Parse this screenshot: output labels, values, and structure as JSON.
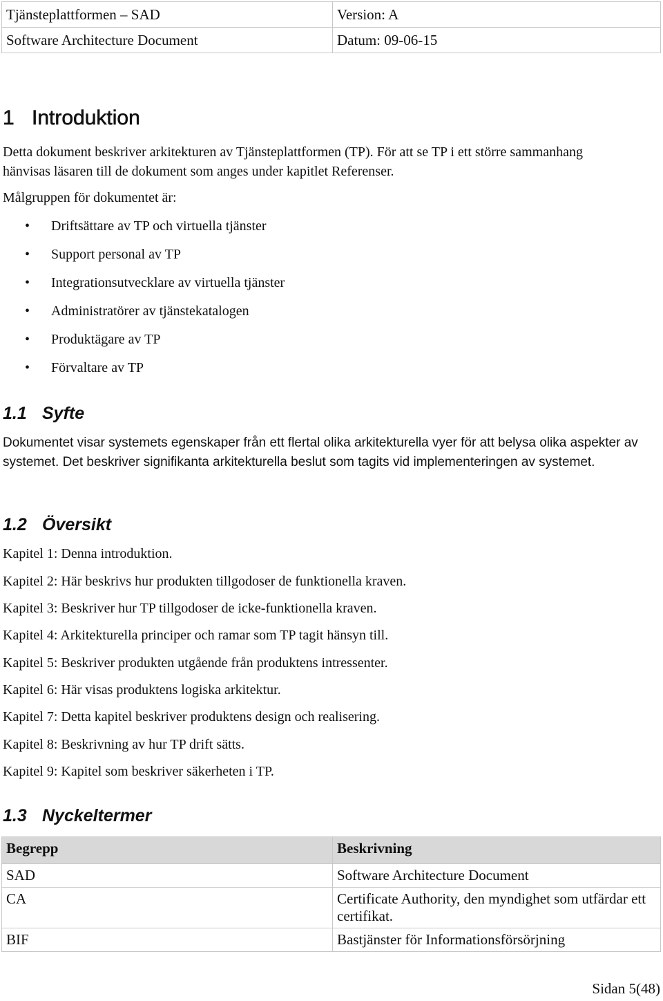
{
  "header": {
    "title": "Tjänsteplattformen – SAD",
    "version": "Version: A",
    "subtitle": "Software Architecture Document",
    "date": "Datum: 09-06-15"
  },
  "section1": {
    "number": "1",
    "title": "Introduktion",
    "intro": "Detta dokument beskriver arkitekturen av Tjänsteplattformen (TP). För att se TP i ett större sammanhang hänvisas läsaren till de dokument som anges under kapitlet Referenser.",
    "audience_label": "Målgruppen för dokumentet är:",
    "audience": [
      "Driftsättare av TP och virtuella tjänster",
      "Support personal av TP",
      "Integrationsutvecklare av virtuella tjänster",
      "Administratörer av tjänstekatalogen",
      "Produktägare av TP",
      "Förvaltare av TP"
    ]
  },
  "section1_1": {
    "number": "1.1",
    "title": "Syfte",
    "text": "Dokumentet visar systemets egenskaper från ett flertal olika arkitekturella vyer för att belysa olika aspekter av systemet. Det beskriver signifikanta arkitekturella beslut som tagits vid implementeringen av systemet."
  },
  "section1_2": {
    "number": "1.2",
    "title": "Översikt",
    "chapters": [
      "Kapitel 1: Denna introduktion.",
      "Kapitel 2: Här beskrivs hur produkten tillgodoser de funktionella kraven.",
      "Kapitel 3: Beskriver hur TP tillgodoser de icke-funktionella kraven.",
      "Kapitel 4: Arkitekturella principer och ramar som TP tagit hänsyn till.",
      "Kapitel 5: Beskriver produkten utgående från produktens intressenter.",
      "Kapitel 6: Här visas produktens logiska arkitektur.",
      "Kapitel 7: Detta kapitel beskriver produktens design och realisering.",
      "Kapitel 8: Beskrivning av hur TP drift sätts.",
      "Kapitel 9: Kapitel som beskriver säkerheten i TP."
    ]
  },
  "section1_3": {
    "number": "1.3",
    "title": "Nyckeltermer",
    "columns": [
      "Begrepp",
      "Beskrivning"
    ],
    "rows": [
      [
        "SAD",
        "Software Architecture Document"
      ],
      [
        "CA",
        "Certificate Authority, den myndighet som utfärdar ett certifikat."
      ],
      [
        "BIF",
        "Bastjänster för Informationsförsörjning"
      ]
    ]
  },
  "footer": {
    "page": "Sidan 5(48)"
  }
}
